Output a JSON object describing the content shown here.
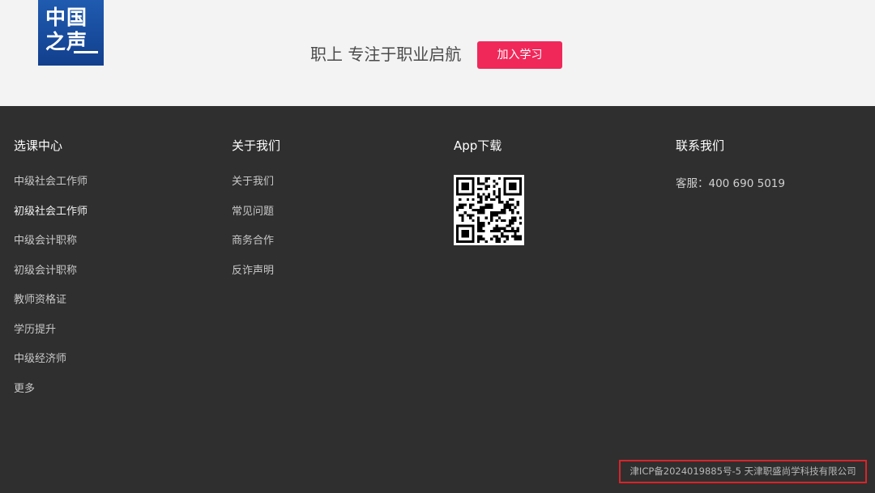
{
  "header": {
    "logo_line1": "中国",
    "logo_line2": "之声",
    "tagline": "职上 专注于职业启航",
    "join_button": "加入学习"
  },
  "footer": {
    "courses": {
      "title": "选课中心",
      "items": [
        "中级社会工作师",
        "初级社会工作师",
        "中级会计职称",
        "初级会计职称",
        "教师资格证",
        "学历提升",
        "中级经济师",
        "更多"
      ]
    },
    "about": {
      "title": "关于我们",
      "items": [
        "关于我们",
        "常见问题",
        "商务合作",
        "反诈声明"
      ]
    },
    "app": {
      "title": "App下载",
      "qr_icon": "qr-code"
    },
    "contact": {
      "title": "联系我们",
      "service": "客服：400 690 5019"
    },
    "icp": "津ICP备2024019885号-5 天津职盛尚学科技有限公司"
  },
  "colors": {
    "accent": "#f0285a",
    "footer_bg": "#2f2f2f",
    "header_bg": "#f3f3f3",
    "logo_blue": "#1a4f9f",
    "highlight_border": "#d9242a"
  }
}
